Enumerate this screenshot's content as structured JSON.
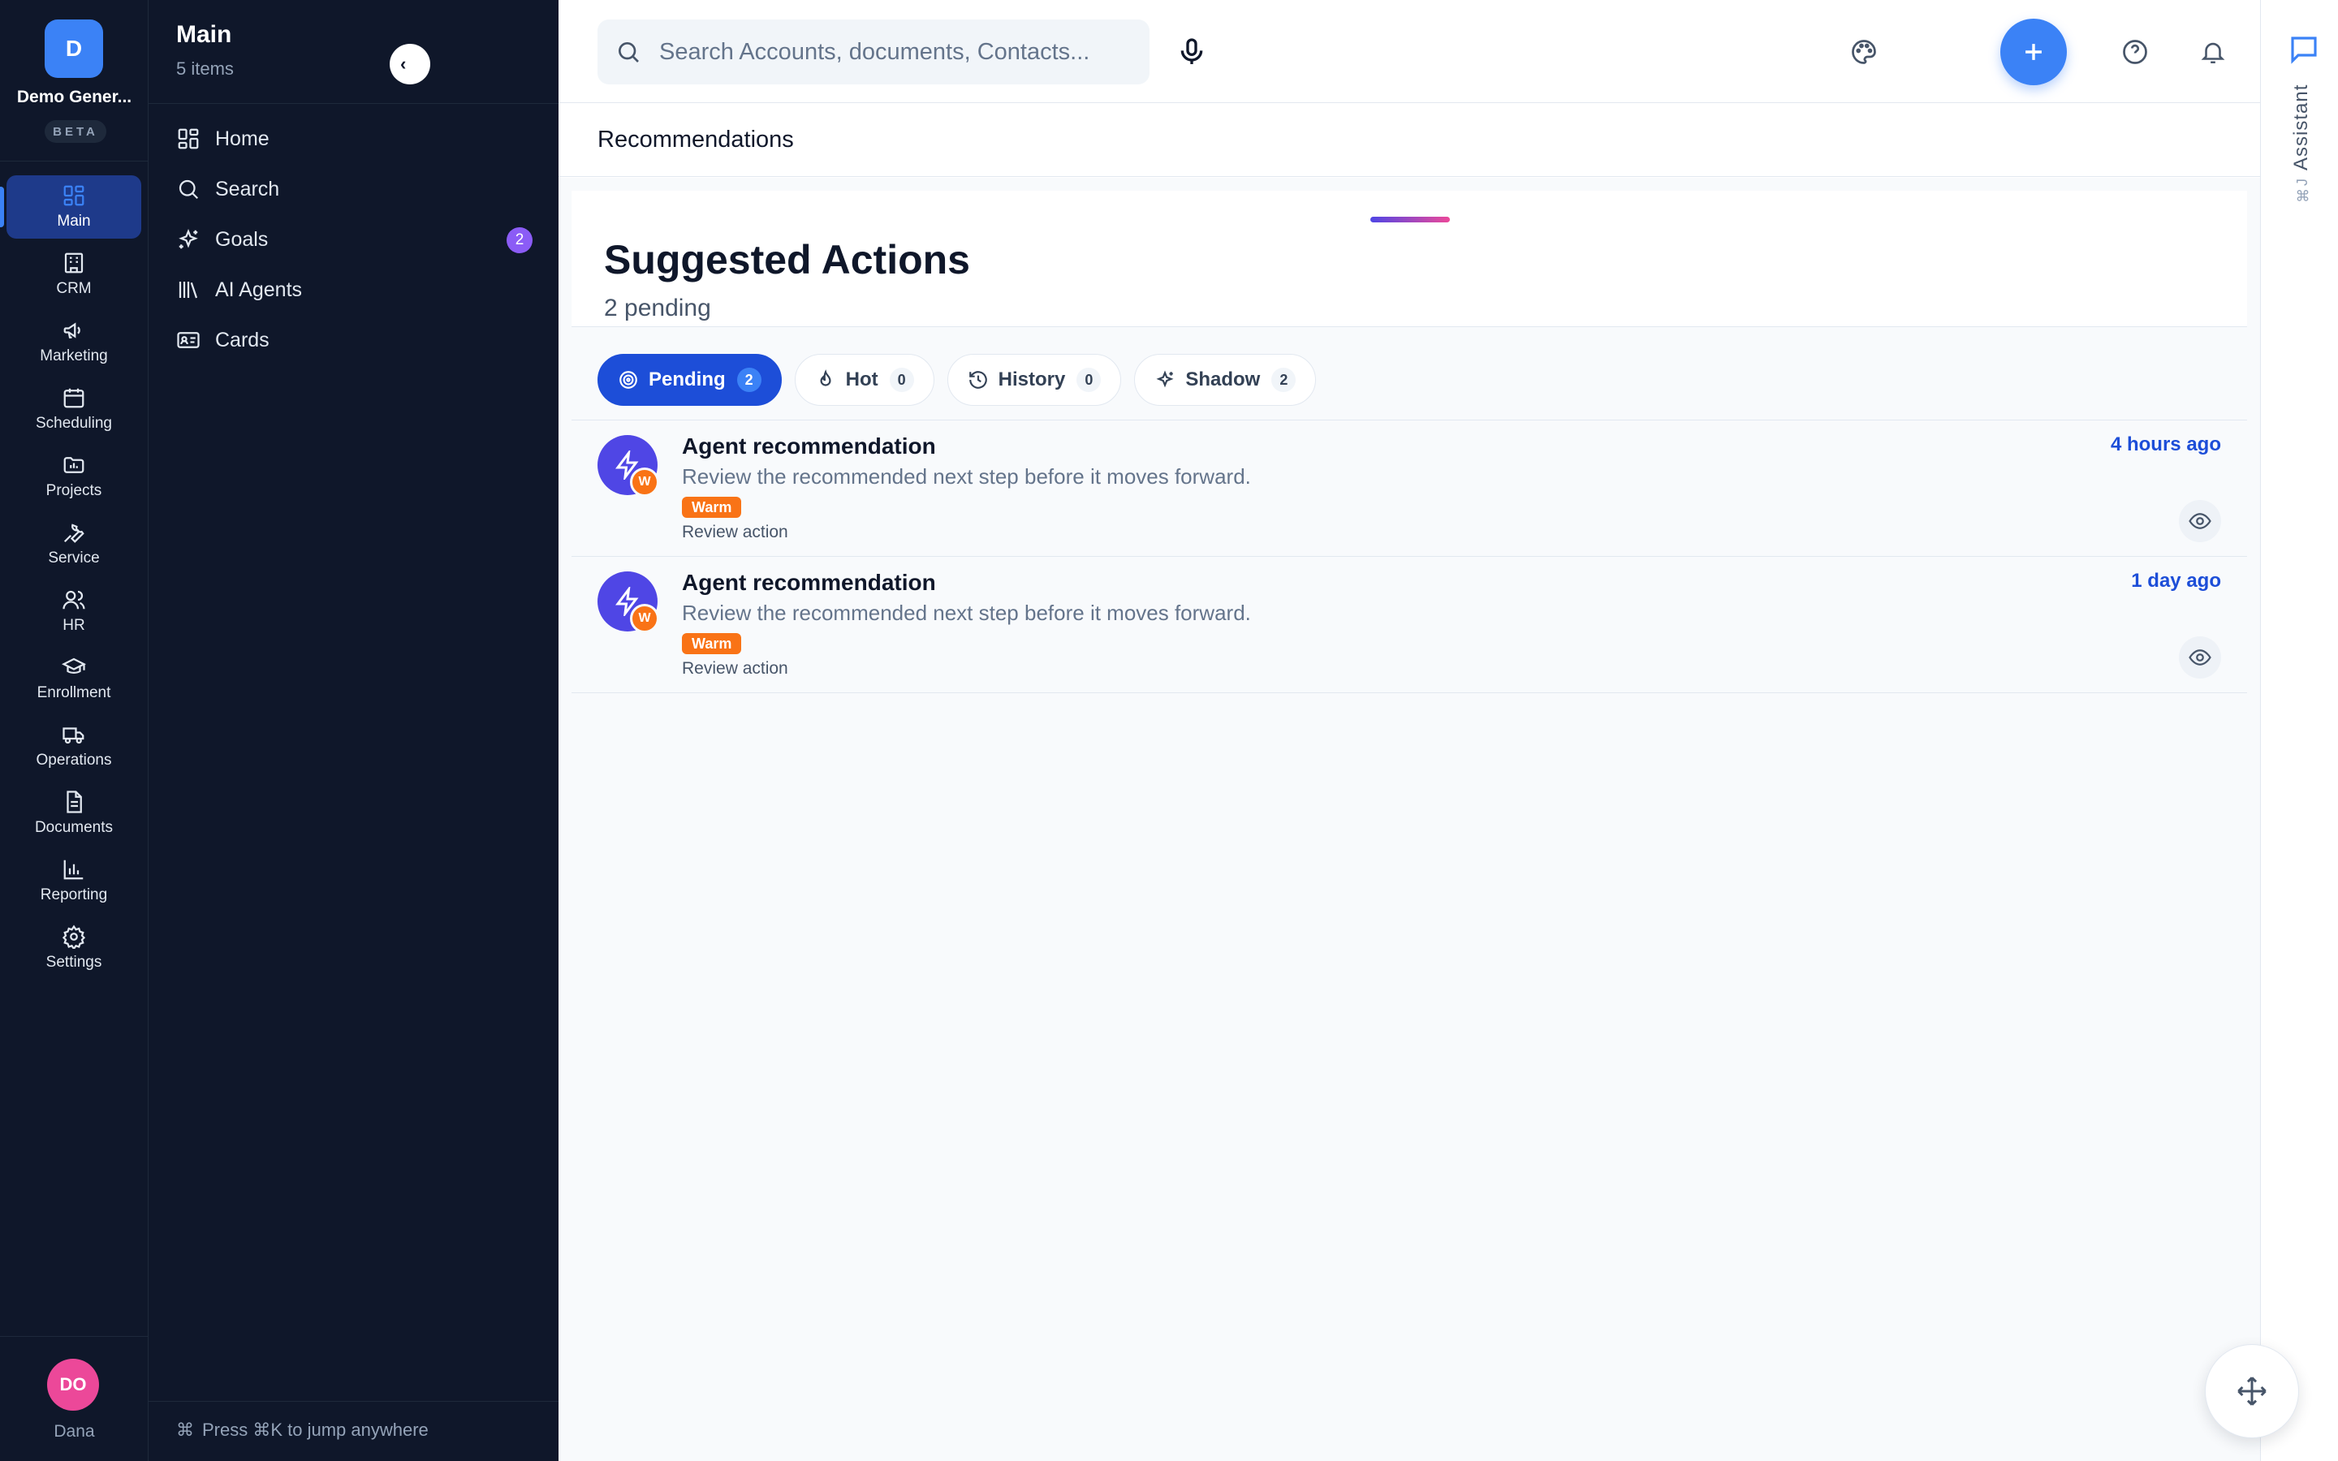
{
  "workspace": {
    "initial": "D",
    "name": "Demo Gener...",
    "badge": "BETA"
  },
  "rail": {
    "items": [
      {
        "label": "Main",
        "icon": "grid-icon"
      },
      {
        "label": "CRM",
        "icon": "building-icon"
      },
      {
        "label": "Marketing",
        "icon": "megaphone-icon"
      },
      {
        "label": "Scheduling",
        "icon": "calendar-icon"
      },
      {
        "label": "Projects",
        "icon": "folder-chart-icon"
      },
      {
        "label": "Service",
        "icon": "wrench-icon"
      },
      {
        "label": "HR",
        "icon": "users-icon"
      },
      {
        "label": "Enrollment",
        "icon": "graduation-cap-icon"
      },
      {
        "label": "Operations",
        "icon": "truck-icon"
      },
      {
        "label": "Documents",
        "icon": "document-icon"
      },
      {
        "label": "Reporting",
        "icon": "bar-chart-icon"
      },
      {
        "label": "Settings",
        "icon": "gear-icon"
      }
    ]
  },
  "user": {
    "initials": "DO",
    "name": "Dana"
  },
  "sidebar": {
    "title": "Main",
    "count": "5 items",
    "items": [
      {
        "label": "Home",
        "icon": "grid-icon"
      },
      {
        "label": "Search",
        "icon": "search-icon"
      },
      {
        "label": "Goals",
        "icon": "sparkles-icon",
        "badge": "2"
      },
      {
        "label": "AI Agents",
        "icon": "library-icon"
      },
      {
        "label": "Cards",
        "icon": "id-card-icon"
      }
    ],
    "footer": {
      "kbd": "⌘",
      "text": "Press ⌘K to jump anywhere"
    }
  },
  "topbar": {
    "search_placeholder": "Search Accounts, documents, Contacts..."
  },
  "page": {
    "title": "Recommendations"
  },
  "suggested": {
    "title": "Suggested Actions",
    "subtitle": "2 pending",
    "filters": [
      {
        "label": "Pending",
        "count": "2",
        "active": true
      },
      {
        "label": "Hot",
        "count": "0"
      },
      {
        "label": "History",
        "count": "0"
      },
      {
        "label": "Shadow",
        "count": "2"
      }
    ],
    "rows": [
      {
        "title": "Agent recommendation",
        "description": "Review the recommended next step before it moves forward.",
        "tag": "Warm",
        "badge": "W",
        "action": "Review action",
        "time": "4 hours ago"
      },
      {
        "title": "Agent recommendation",
        "description": "Review the recommended next step before it moves forward.",
        "tag": "Warm",
        "badge": "W",
        "action": "Review action",
        "time": "1 day ago"
      }
    ]
  },
  "assistant": {
    "label": "Assistant",
    "kbd": "⌘J"
  },
  "colors": {
    "accent": "#3b82f6",
    "sidebar_bg": "#0f172a",
    "active_chip": "#1d4ed8",
    "warm": "#f97316",
    "goals_badge": "#8b5cf6",
    "avatar": "#ec4899"
  }
}
